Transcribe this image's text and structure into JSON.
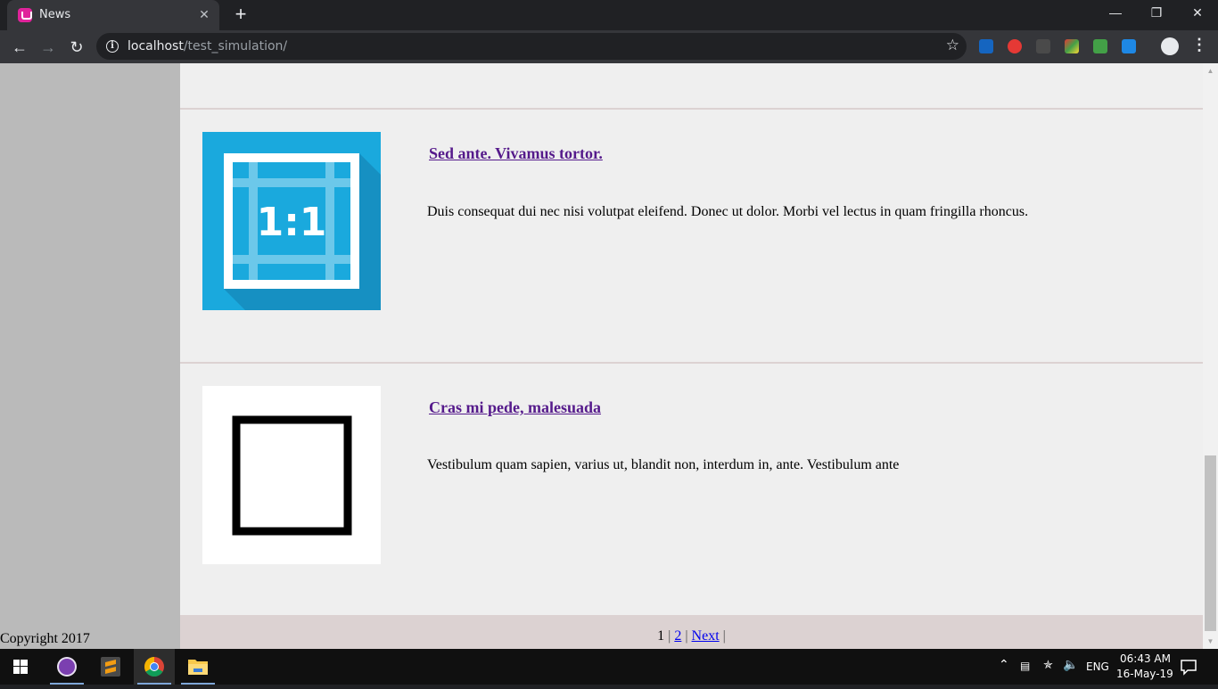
{
  "browser": {
    "tab_title": "News",
    "tab_close": "✕",
    "new_tab": "+",
    "url_host": "localhost",
    "url_path": "/test_simulation/",
    "window_controls": {
      "minimize": "—",
      "restore": "❐",
      "close": "✕"
    }
  },
  "sidebar": {
    "copyright": "Copyright 2017"
  },
  "posts": [
    {
      "title": "Sed ante. Vivamus tortor.",
      "body": "Duis consequat dui nec nisi volutpat eleifend. Donec ut dolor. Morbi vel lectus in quam fringilla rhoncus.",
      "image_label": "1:1",
      "image_icon": "aspect-ratio-icon"
    },
    {
      "title": "Cras mi pede, malesuada",
      "body": "Vestibulum quam sapien, varius ut, blandit non, interdum in, ante. Vestibulum ante",
      "image_icon": "square-outline-icon"
    }
  ],
  "pagination": {
    "current": "1",
    "sep1": "|",
    "page2": "2",
    "sep2": "|",
    "next": "Next",
    "sep3": "|"
  },
  "taskbar": {
    "language": "ENG",
    "time": "06:43 AM",
    "date": "16-May-19"
  },
  "colors": {
    "sidebar": "#bababa",
    "main_bg": "#efefef",
    "divider": "#dcd2d2",
    "thumb_blue": "#1aa9dd",
    "visited_link": "#551a8b",
    "link": "#0000ee"
  }
}
